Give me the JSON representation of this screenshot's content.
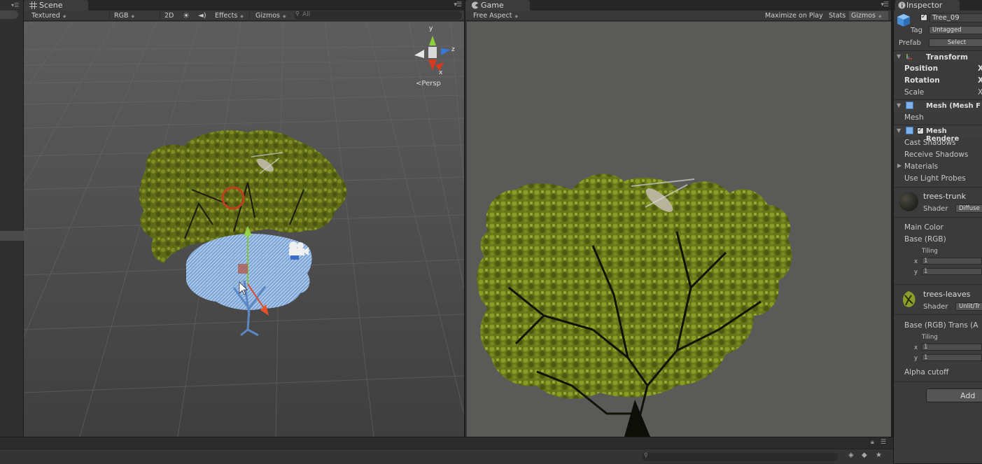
{
  "scene": {
    "tab_label": "Scene",
    "toolbar": {
      "draw_mode": "Textured",
      "render_mode": "RGB",
      "mode_2d": "2D",
      "effects": "Effects",
      "gizmos": "Gizmos",
      "search_placeholder": "All"
    },
    "gizmo": {
      "axis_y": "y",
      "axis_z": "z",
      "axis_x": "x",
      "projection": "Persp"
    }
  },
  "game": {
    "tab_label": "Game",
    "aspect": "Free Aspect",
    "maximize_on_play": "Maximize on Play",
    "stats": "Stats",
    "gizmos": "Gizmos"
  },
  "inspector": {
    "tab_label": "Inspector",
    "object_name": "Tree_09",
    "tag_label": "Tag",
    "tag_value": "Untagged",
    "prefab_label": "Prefab",
    "prefab_select": "Select",
    "transform": {
      "title": "Transform",
      "position": "Position",
      "rotation": "Rotation",
      "scale": "Scale",
      "axis_x": "X"
    },
    "mesh_filter": {
      "title": "Mesh (Mesh F",
      "mesh": "Mesh"
    },
    "mesh_renderer": {
      "title": "Mesh Rendere",
      "cast_shadows": "Cast Shadows",
      "receive_shadows": "Receive Shadows",
      "materials": "Materials",
      "use_light_probes": "Use Light Probes"
    },
    "material_trunk": {
      "name": "trees-trunk",
      "shader_label": "Shader",
      "shader_value": "Diffuse",
      "main_color": "Main Color",
      "base": "Base (RGB)",
      "tiling": "Tiling",
      "x": "x",
      "y": "y",
      "x_val": "1",
      "y_val": "1"
    },
    "material_leaves": {
      "name": "trees-leaves",
      "shader_label": "Shader",
      "shader_value": "Unlit/Tr",
      "base": "Base (RGB) Trans (A",
      "tiling": "Tiling",
      "x": "x",
      "y": "y",
      "x_val": "1",
      "y_val": "1",
      "alpha_cutoff": "Alpha cutoff"
    },
    "add_component": "Add"
  },
  "colors": {
    "panel_bg": "#3a3a3a",
    "leaves": "#6e7a1c",
    "selection_blue": "#8fb8e8",
    "game_bg": "#5a5a58"
  }
}
